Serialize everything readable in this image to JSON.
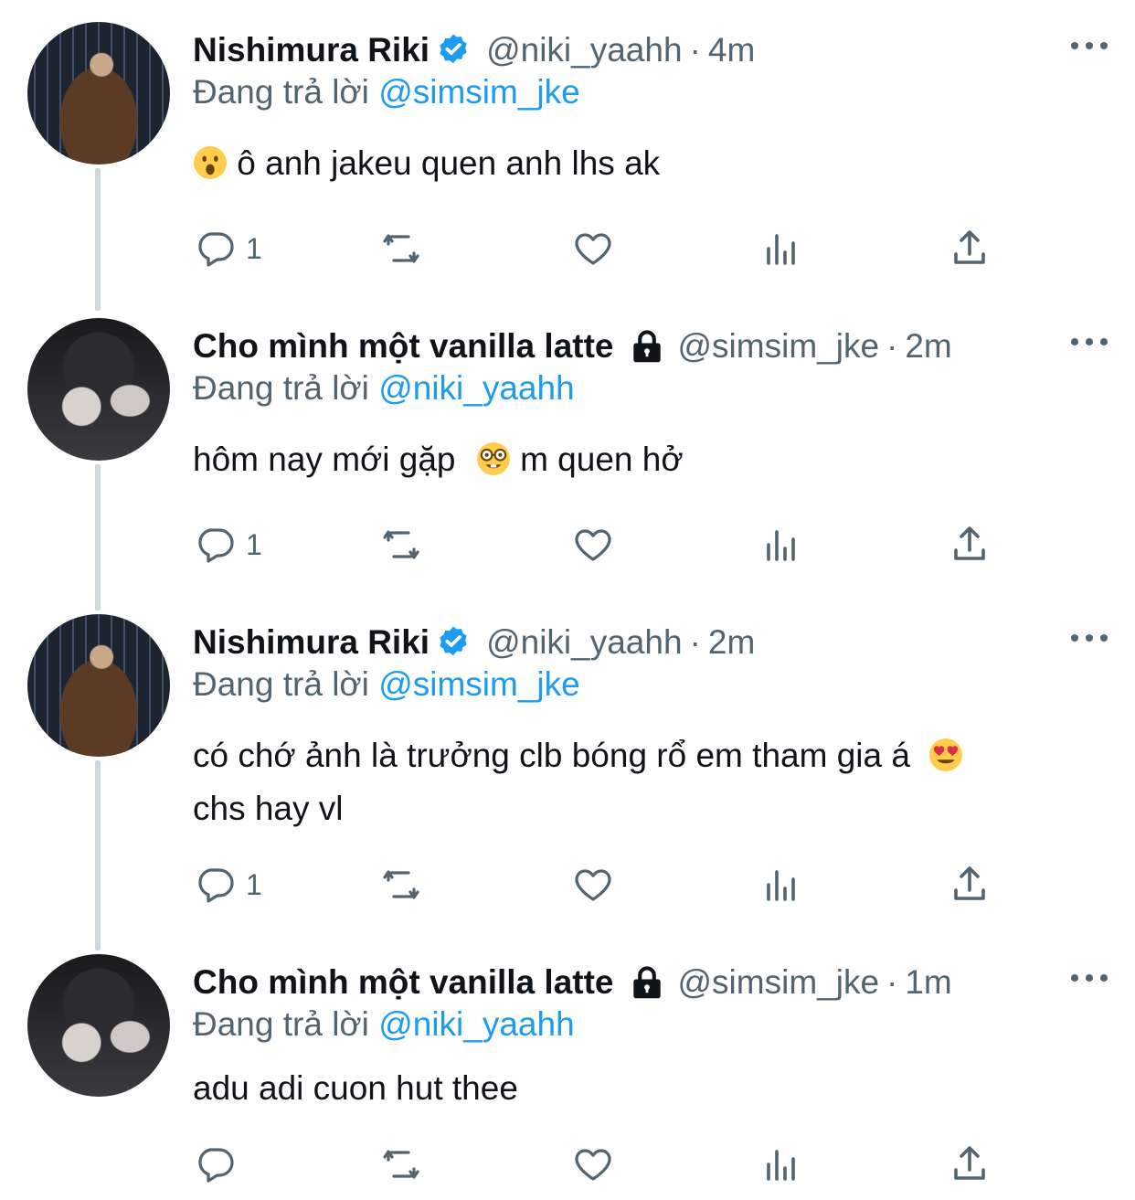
{
  "tweets": [
    {
      "name": "Nishimura Riki",
      "verified": true,
      "protected": false,
      "handle": "@niki_yaahh",
      "time": "4m",
      "reply_prefix": "Đang trả lời",
      "reply_to": "@simsim_jke",
      "text_before": "ô anh jakeu quen anh lhs ak",
      "emoji_lead": "face-with-open-mouth",
      "reply_count": "1"
    },
    {
      "name": "Cho mình một vanilla latte",
      "verified": false,
      "protected": true,
      "handle": "@simsim_jke",
      "time": "2m",
      "reply_prefix": "Đang trả lời",
      "reply_to": "@niki_yaahh",
      "text_before": "hôm nay mới gặp",
      "emoji_mid": "nerd-face",
      "text_after": " m quen hở",
      "reply_count": "1"
    },
    {
      "name": "Nishimura Riki",
      "verified": true,
      "protected": false,
      "handle": "@niki_yaahh",
      "time": "2m",
      "reply_prefix": "Đang trả lời",
      "reply_to": "@simsim_jke",
      "text_before": "có chớ ảnh là trưởng clb bóng rổ em tham gia á",
      "emoji_mid": "heart-eyes",
      "text_after": "chs hay vl",
      "reply_count": "1"
    },
    {
      "name": "Cho mình một vanilla latte",
      "verified": false,
      "protected": true,
      "handle": "@simsim_jke",
      "time": "1m",
      "reply_prefix": "Đang trả lời",
      "reply_to": "@niki_yaahh",
      "text_before": "adu adi cuon hut thee",
      "reply_count": ""
    }
  ],
  "separator": "·",
  "icons": {
    "reply": "reply-icon",
    "retweet": "retweet-icon",
    "like": "heart-icon",
    "views": "analytics-icon",
    "share": "share-icon",
    "more": "more-icon",
    "verified": "verified-badge-icon",
    "protected": "lock-icon"
  },
  "colors": {
    "text": "#0f1419",
    "muted": "#536471",
    "accent": "#1d9bf0",
    "thread_line": "#cfd9de"
  }
}
